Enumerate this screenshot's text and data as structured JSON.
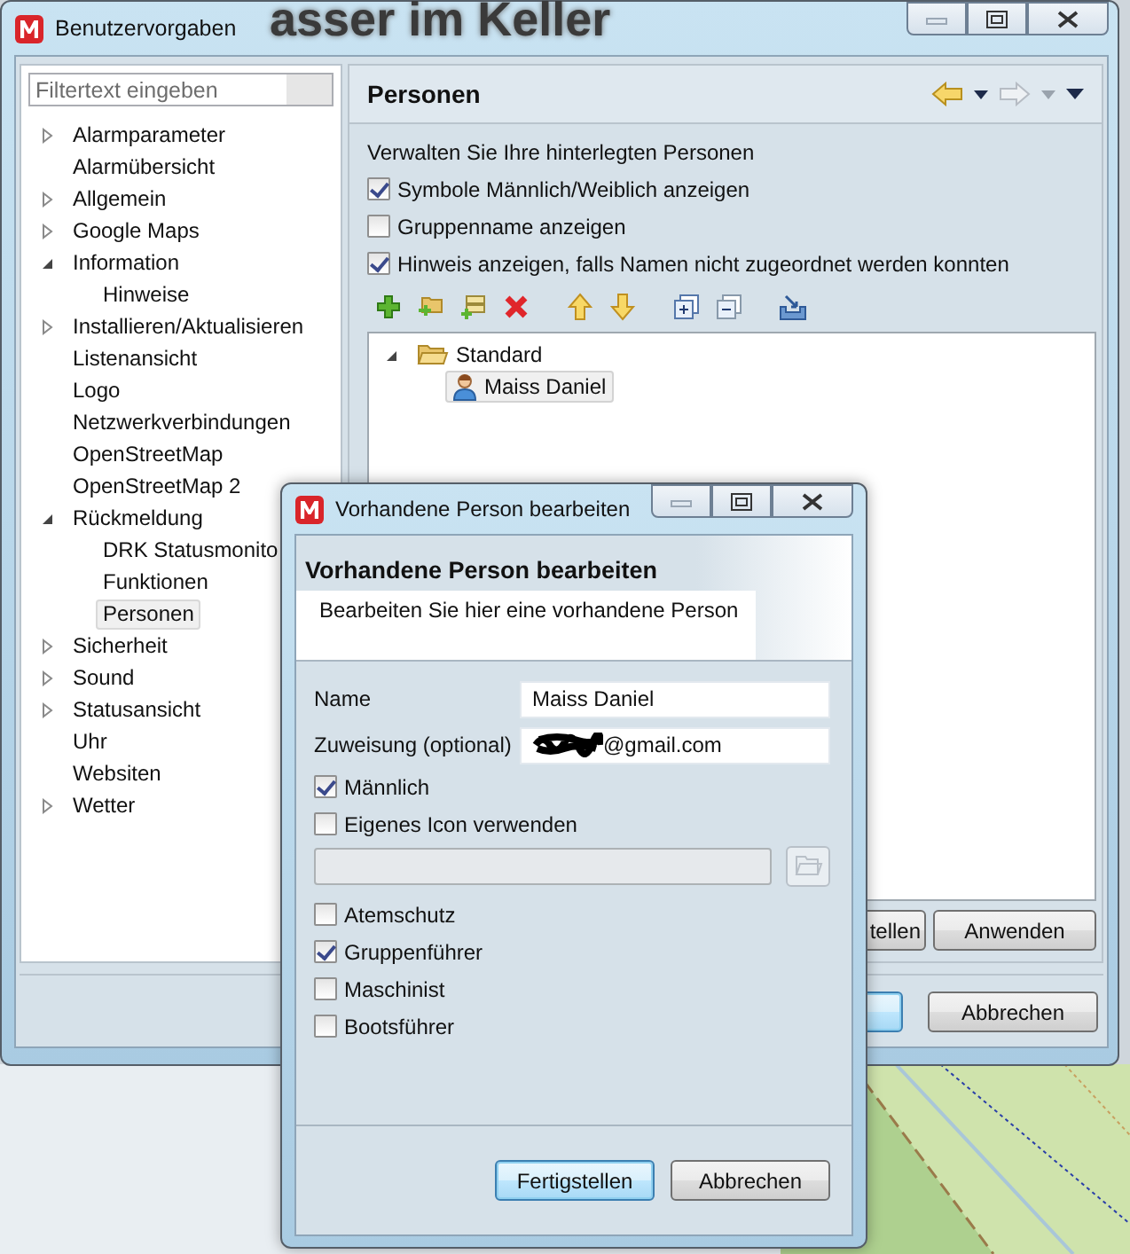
{
  "desktop": {
    "background_text": "asser im Keller"
  },
  "main_window": {
    "title": "Benutzervorgaben",
    "filter": {
      "placeholder": "Filtertext eingeben"
    },
    "nav": [
      {
        "label": "Alarmparameter",
        "kind": "branch",
        "expanded": false,
        "selected": false
      },
      {
        "label": "Alarmübersicht",
        "kind": "leaf",
        "selected": false
      },
      {
        "label": "Allgemein",
        "kind": "branch",
        "expanded": false,
        "selected": false
      },
      {
        "label": "Google Maps",
        "kind": "branch",
        "expanded": false,
        "selected": false
      },
      {
        "label": "Information",
        "kind": "branch",
        "expanded": true,
        "selected": false,
        "children": [
          {
            "label": "Hinweise",
            "kind": "leaf",
            "selected": false
          }
        ]
      },
      {
        "label": "Installieren/Aktualisieren",
        "kind": "branch",
        "expanded": false,
        "selected": false
      },
      {
        "label": "Listenansicht",
        "kind": "leaf",
        "selected": false
      },
      {
        "label": "Logo",
        "kind": "leaf",
        "selected": false
      },
      {
        "label": "Netzwerkverbindungen",
        "kind": "leaf",
        "selected": false
      },
      {
        "label": "OpenStreetMap",
        "kind": "leaf",
        "selected": false
      },
      {
        "label": "OpenStreetMap 2",
        "kind": "leaf",
        "selected": false
      },
      {
        "label": "Rückmeldung",
        "kind": "branch",
        "expanded": true,
        "selected": false,
        "children": [
          {
            "label": "DRK Statusmonito",
            "kind": "leaf",
            "selected": false
          },
          {
            "label": "Funktionen",
            "kind": "leaf",
            "selected": false
          },
          {
            "label": "Personen",
            "kind": "leaf",
            "selected": true
          }
        ]
      },
      {
        "label": "Sicherheit",
        "kind": "branch",
        "expanded": false,
        "selected": false
      },
      {
        "label": "Sound",
        "kind": "branch",
        "expanded": false,
        "selected": false
      },
      {
        "label": "Statusansicht",
        "kind": "branch",
        "expanded": false,
        "selected": false
      },
      {
        "label": "Uhr",
        "kind": "leaf",
        "selected": false
      },
      {
        "label": "Websiten",
        "kind": "leaf",
        "selected": false
      },
      {
        "label": "Wetter",
        "kind": "branch",
        "expanded": false,
        "selected": false
      }
    ],
    "page": {
      "title": "Personen",
      "description": "Verwalten Sie Ihre hinterlegten Personen",
      "options": [
        {
          "label": "Symbole Männlich/Weiblich anzeigen",
          "checked": true
        },
        {
          "label": "Gruppenname anzeigen",
          "checked": false
        },
        {
          "label": "Hinweis anzeigen, falls Namen nicht zugeordnet werden konnten",
          "checked": true
        }
      ],
      "tree": [
        {
          "label": "Standard",
          "kind": "folder",
          "expanded": true,
          "selected": false,
          "children": [
            {
              "label": "Maiss Daniel",
              "kind": "person",
              "selected": true
            }
          ]
        }
      ],
      "buttons": [
        {
          "label": "tellen"
        },
        {
          "label": "Anwenden"
        }
      ]
    },
    "footer_buttons": [
      {
        "kind": "default"
      },
      {
        "kind": "normal",
        "label": "Abbrechen"
      }
    ]
  },
  "dialog": {
    "title": "Vorhandene Person bearbeiten",
    "heading": "Vorhandene Person bearbeiten",
    "description": "Bearbeiten Sie hier eine vorhandene Person",
    "fields": [
      {
        "label": "Name",
        "value": "Maiss Daniel",
        "redacted": false
      },
      {
        "label": "Zuweisung (optional)",
        "value": "@gmail.com",
        "redacted": true
      }
    ],
    "gender": {
      "label": "Männlich",
      "checked": true
    },
    "custom_icon": {
      "label": "Eigenes Icon verwenden",
      "checked": false
    },
    "icon_path": {
      "disabled": true
    },
    "roles": [
      {
        "label": "Atemschutz",
        "checked": false
      },
      {
        "label": "Gruppenführer",
        "checked": true
      },
      {
        "label": "Maschinist",
        "checked": false
      },
      {
        "label": "Bootsführer",
        "checked": false
      }
    ],
    "buttons": [
      {
        "kind": "default",
        "label": "Fertigstellen"
      },
      {
        "kind": "normal",
        "label": "Abbrechen"
      }
    ]
  }
}
